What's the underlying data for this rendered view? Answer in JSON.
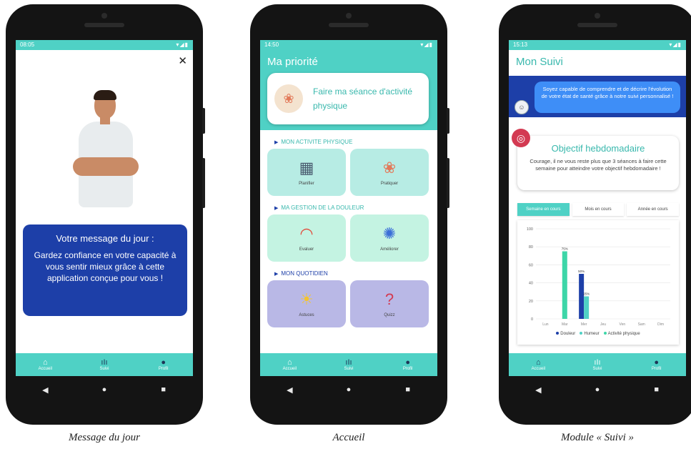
{
  "colors": {
    "teal": "#4fd1c5",
    "teal_text": "#39b8ad",
    "navy": "#1d3fa8",
    "douleur": "#1d3fa8",
    "humeur": "#4fd1c5",
    "activite": "#3dd6a8"
  },
  "nav": {
    "accueil": "Accueil",
    "suivi": "Suivi",
    "profil": "Profil"
  },
  "screen1": {
    "status": {
      "time": "08:05"
    },
    "close": "✕",
    "message_title": "Votre message du jour :",
    "message_body": "Gardez confiance en votre capacité à vous sentir mieux grâce à cette application conçue pour vous !"
  },
  "screen2": {
    "status": {
      "time": "14:50"
    },
    "title": "Ma priorité",
    "priority_text": "Faire ma séance d'activité physique",
    "sections": [
      "MON ACTIVITE PHYSIQUE",
      "MA GESTION DE LA DOULEUR",
      "MON QUOTIDIEN"
    ],
    "tiles": [
      "Planifier",
      "Pratiquer",
      "Evaluer",
      "Améliorer",
      "Astuces",
      "Quizz"
    ]
  },
  "screen3": {
    "status": {
      "time": "15:13"
    },
    "title": "Mon Suivi",
    "bubble": "Soyez capable de comprendre et de décrire l'évolution de votre état de santé grâce à notre suivi personnalisé !",
    "goal_title": "Objectif hebdomadaire",
    "goal_text": "Courage, il ne vous reste plus que 3 séances à faire cette semaine pour atteindre votre objectif hebdomadaire !",
    "tabs": [
      "Semaine en cours",
      "Mois en cours",
      "Année en cours"
    ],
    "legend": [
      "Douleur",
      "Humeur",
      "Activité physique"
    ]
  },
  "captions": [
    "Message du jour",
    "Accueil",
    "Module « Suivi »"
  ],
  "chart_data": {
    "type": "bar",
    "categories": [
      "Lun",
      "Mar",
      "Mer",
      "Jeu",
      "Ven",
      "Sam",
      "Dim"
    ],
    "series": [
      {
        "name": "Douleur",
        "values": [
          0,
          0,
          50,
          0,
          0,
          0,
          0
        ]
      },
      {
        "name": "Humeur",
        "values": [
          0,
          0,
          25,
          0,
          0,
          0,
          0
        ]
      },
      {
        "name": "Activité physique",
        "values": [
          0,
          75,
          0,
          0,
          0,
          0,
          0
        ]
      }
    ],
    "data_labels": [
      "75%",
      "50%",
      "25%"
    ],
    "yticks": [
      0,
      20,
      40,
      60,
      80,
      100
    ],
    "ylim": [
      0,
      100
    ],
    "legend": "bottom"
  }
}
